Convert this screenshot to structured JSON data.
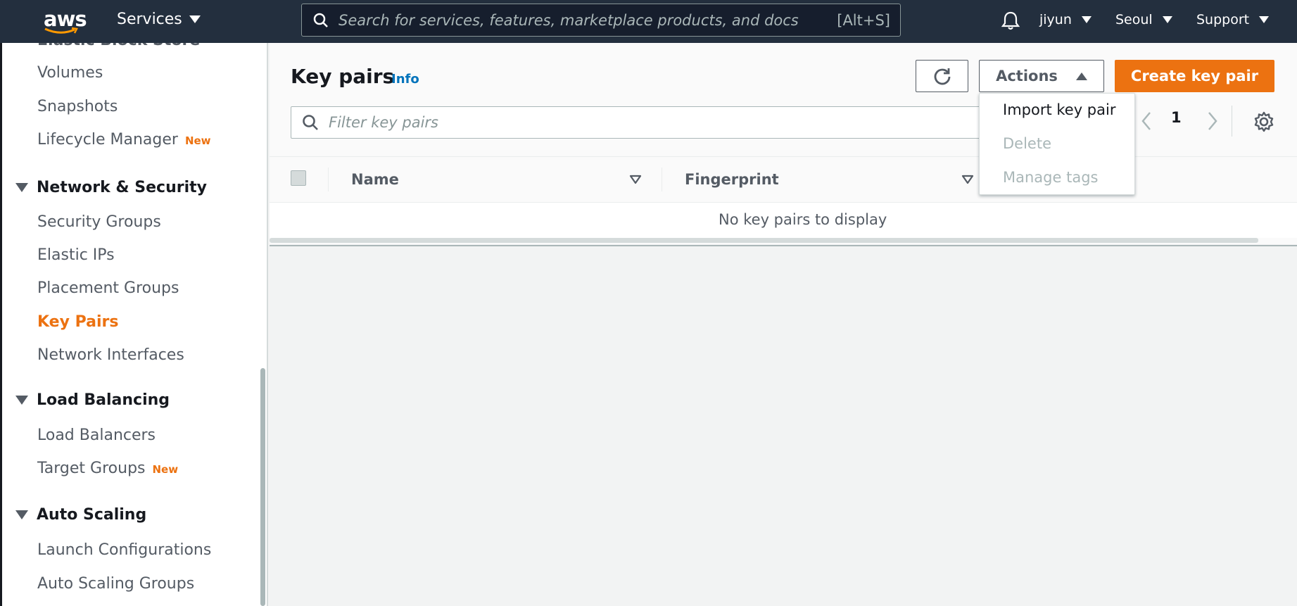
{
  "topnav": {
    "logo_text": "aws",
    "services_label": "Services",
    "search_placeholder": "Search for services, features, marketplace products, and docs",
    "search_shortcut": "[Alt+S]",
    "user": "jiyun",
    "region": "Seoul",
    "support": "Support"
  },
  "sidebar": {
    "partial_title": "Elastic Block Store",
    "ebs_items": [
      "Volumes",
      "Snapshots",
      "Lifecycle Manager"
    ],
    "new_badge": "New",
    "network_head": "Network & Security",
    "network_items": [
      "Security Groups",
      "Elastic IPs",
      "Placement Groups",
      "Key Pairs",
      "Network Interfaces"
    ],
    "lb_head": "Load Balancing",
    "lb_items": [
      "Load Balancers",
      "Target Groups"
    ],
    "as_head": "Auto Scaling",
    "as_items": [
      "Launch Configurations",
      "Auto Scaling Groups"
    ]
  },
  "main": {
    "title": "Key pairs",
    "info": "Info",
    "actions_label": "Actions",
    "create_label": "Create key pair",
    "filter_placeholder": "Filter key pairs",
    "page_number": "1",
    "columns": [
      "Name",
      "Fingerprint"
    ],
    "empty_message": "No key pairs to display"
  },
  "actions_menu": {
    "items": [
      "Import key pair",
      "Delete",
      "Manage tags"
    ]
  },
  "colors": {
    "accent": "#ec7211",
    "nav_bg": "#232f3e",
    "link": "#0073bb"
  }
}
